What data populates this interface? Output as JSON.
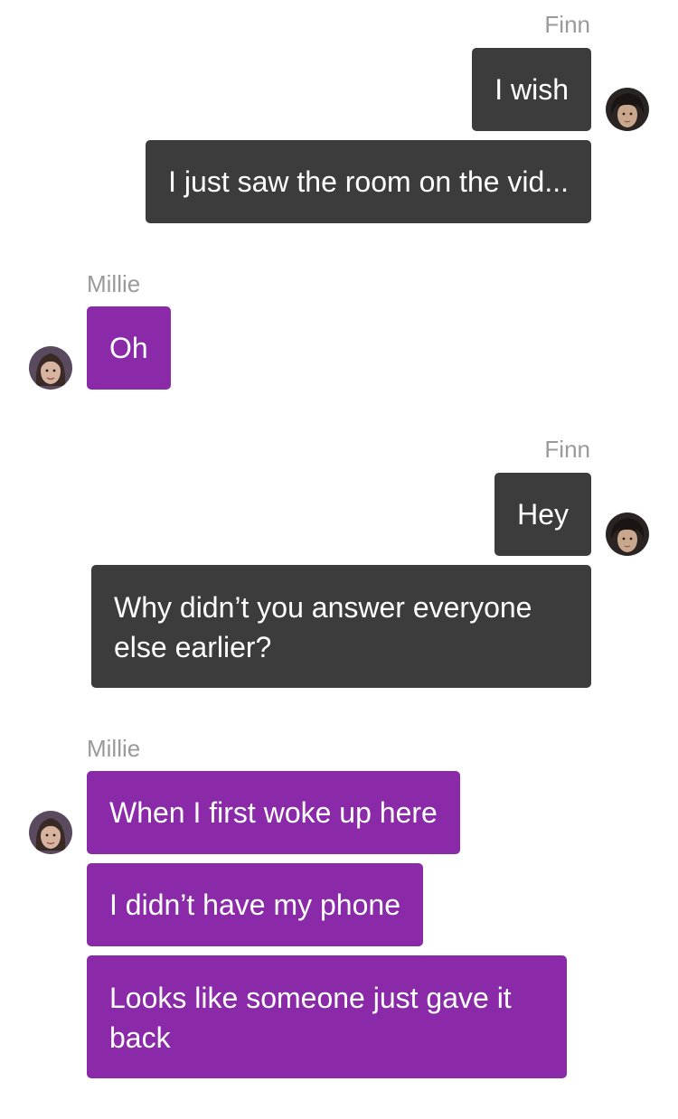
{
  "colors": {
    "sent_bubble": "#3c3c3c",
    "received_bubble": "#8a2aa8",
    "sender_name": "#9a9a9a",
    "bubble_text": "#ffffff"
  },
  "groups": [
    {
      "sender": "Finn",
      "side": "right",
      "avatar_icon": "finn-avatar-icon",
      "messages": [
        "I wish",
        "I just saw the room on the vid..."
      ]
    },
    {
      "sender": "Millie",
      "side": "left",
      "avatar_icon": "millie-avatar-icon",
      "messages": [
        "Oh"
      ]
    },
    {
      "sender": "Finn",
      "side": "right",
      "avatar_icon": "finn-avatar-icon",
      "messages": [
        "Hey",
        "Why didn’t you answer everyone else earlier?"
      ]
    },
    {
      "sender": "Millie",
      "side": "left",
      "avatar_icon": "millie-avatar-icon",
      "messages": [
        "When I first woke up here",
        "I didn’t have my phone",
        "Looks like someone just gave it back"
      ]
    }
  ]
}
